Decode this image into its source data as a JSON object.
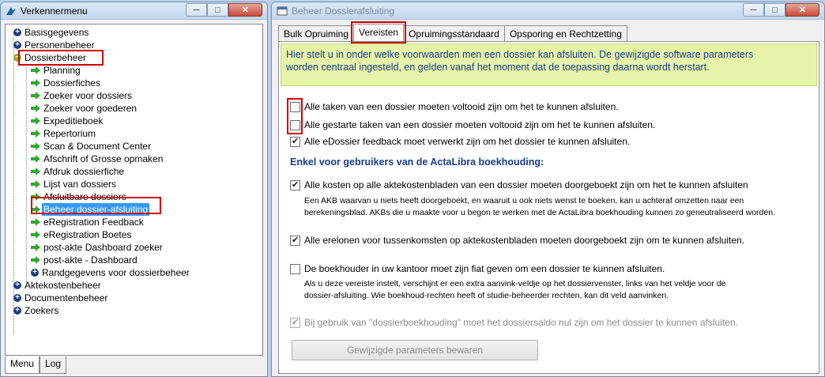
{
  "menu_window": {
    "title": "Verkennermenu",
    "tree": [
      {
        "label": "Basisgegevens",
        "type": "plus",
        "level": 1
      },
      {
        "label": "Personenbeheer",
        "type": "plus",
        "level": 1
      },
      {
        "label": "Dossierbeheer",
        "type": "minus",
        "level": 1
      },
      {
        "label": "Planning",
        "type": "arrow",
        "level": 2
      },
      {
        "label": "Dossierfiches",
        "type": "arrow",
        "level": 2
      },
      {
        "label": "Zoeker voor dossiers",
        "type": "arrow",
        "level": 2
      },
      {
        "label": "Zoeker voor goederen",
        "type": "arrow",
        "level": 2
      },
      {
        "label": "Expeditieboek",
        "type": "arrow",
        "level": 2
      },
      {
        "label": "Repertorium",
        "type": "arrow",
        "level": 2
      },
      {
        "label": "Scan & Document Center",
        "type": "arrow",
        "level": 2
      },
      {
        "label": "Afschrift of Grosse opmaken",
        "type": "arrow",
        "level": 2
      },
      {
        "label": "Afdruk dossierfiche",
        "type": "arrow",
        "level": 2
      },
      {
        "label": "Lijst van dossiers",
        "type": "arrow",
        "level": 2
      },
      {
        "label": "Afsluitbare dossiers",
        "type": "arrow",
        "level": 2
      },
      {
        "label": "Beheer dossier-afsluiting",
        "type": "arrow",
        "level": 2,
        "selected": true
      },
      {
        "label": "eRegistration Feedback",
        "type": "arrow",
        "level": 2
      },
      {
        "label": "eRegistration Boetes",
        "type": "arrow",
        "level": 2
      },
      {
        "label": "post-akte Dashboard zoeker",
        "type": "arrow",
        "level": 2
      },
      {
        "label": "post-akte - Dashboard",
        "type": "arrow",
        "level": 2
      },
      {
        "label": "Randgegevens voor dossierbeheer",
        "type": "plus",
        "level": 2
      },
      {
        "label": "Aktekostenbeheer",
        "type": "plus",
        "level": 1
      },
      {
        "label": "Documentenbeheer",
        "type": "plus",
        "level": 1
      },
      {
        "label": "Zoekers",
        "type": "plus",
        "level": 1
      }
    ],
    "bottom_tabs": [
      "Menu",
      "Log"
    ]
  },
  "beheer_window": {
    "title": "Beheer Dossierafsluiting",
    "tabs": [
      "Bulk Opruiming",
      "Vereisten",
      "Opruimingsstandaard",
      "Opsporing en Rechtzetting"
    ],
    "active_tab": "Vereisten",
    "notice_line1": "Hier stelt u in onder welke voorwaarden men een dossier kan afsluiten. De gewijzigde software parameters",
    "notice_line2": "worden centraal ingesteld, en gelden vanaf het moment dat de toepassing daarna wordt herstart.",
    "options": {
      "opt1": {
        "label": "Alle taken van een dossier moeten voltooid zijn om het te kunnen afsluiten.",
        "checked": false
      },
      "opt2": {
        "label": "Alle gestarte taken van een dossier moeten voltooid zijn om het te kunnen afsluiten.",
        "checked": false
      },
      "opt3": {
        "label": "Alle eDossier feedback moet verwerkt zijn om het dossier te kunnen afsluiten.",
        "checked": true
      }
    },
    "heading": "Enkel voor gebruikers van de ActaLibra boekhouding:",
    "akb_options": {
      "opt4": {
        "label": "Alle kosten op alle aktekostenbladen van een dossier moeten doorgeboekt zijn om het te kunnen afsluiten",
        "checked": true
      },
      "note4_line1": "Een AKB waarvan u niets heeft doorgeboekt, en waaruit u ook niets wenst te boeken, kan u achteraf omzetten naar een",
      "note4_line2": "berekeningsblad.  AKBs die u maakte voor u begon te werken met de ActaLibra boekhouding kunnen zo geneutraliseerd worden.",
      "opt5": {
        "label": "Alle erelonen voor tussenkomsten op aktekostenbladen moeten doorgeboekt zijn om te kunnen afsluiten.",
        "checked": true
      },
      "opt6": {
        "label": "De boekhouder in uw kantoor moet zijn fiat geven om een dossier te kunnen afsluiten.",
        "checked": false
      },
      "note6_line1": "Als u deze vereiste instelt, verschijnt er een extra aanvink-veldje op het dossiervenster, links van het veldje voor de",
      "note6_line2": "dossier-afsluiting.  Wie boekhoud-rechten heeft of studie-beheerder rechten, kan dit veld aanvinken.",
      "opt7": {
        "label": "Bij gebruik van \"dossierboekhouding\" moet het dossiersaldo nul zijn om het dossier te kunnen afsluiten.",
        "checked": true,
        "disabled": true
      }
    },
    "save_button": "Gewijzigde parameters bewaren"
  },
  "colors": {
    "notice_bg": "#e5f4a8",
    "notice_text": "#1a3c8c",
    "highlight": "#cc0000",
    "selection": "#3399ff"
  }
}
